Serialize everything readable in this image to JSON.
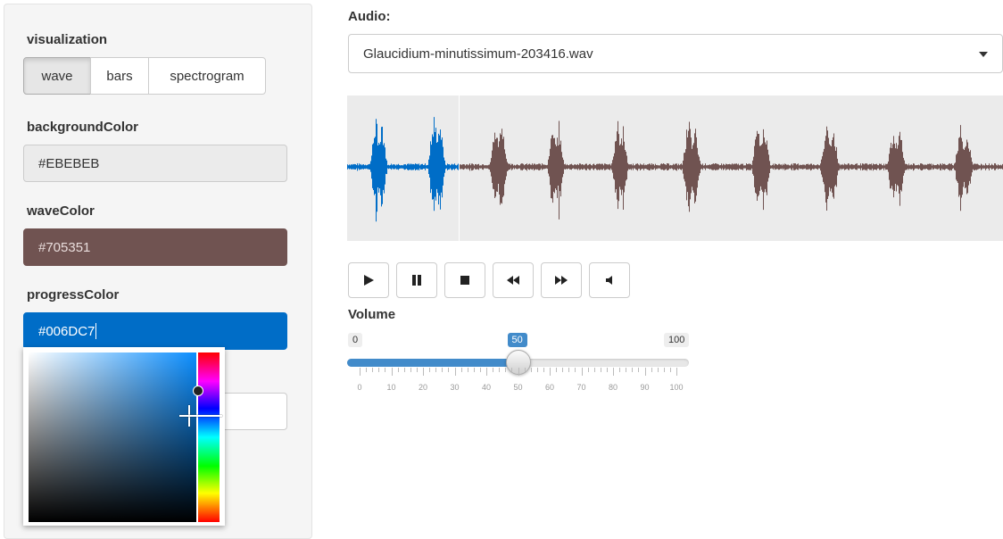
{
  "sidebar": {
    "visualization_label": "visualization",
    "visualization_options": [
      "wave",
      "bars",
      "spectrogram"
    ],
    "visualization_selected": "wave",
    "background_color_label": "backgroundColor",
    "background_color_value": "#EBEBEB",
    "wave_color_label": "waveColor",
    "wave_color_value": "#705351",
    "progress_color_label": "progressColor",
    "progress_color_value": "#006DC7"
  },
  "main": {
    "audio_label": "Audio:",
    "audio_selected": "Glaucidium-minutissimum-203416.wav",
    "wave_color": "#705351",
    "progress_color": "#006DC7",
    "background_color": "#EBEBEB",
    "playback_progress": 0.17,
    "controls": [
      {
        "name": "play-button",
        "icon": "play-icon"
      },
      {
        "name": "pause-button",
        "icon": "pause-icon"
      },
      {
        "name": "stop-button",
        "icon": "stop-icon"
      },
      {
        "name": "rewind-button",
        "icon": "rewind-icon"
      },
      {
        "name": "forward-button",
        "icon": "forward-icon"
      },
      {
        "name": "mute-button",
        "icon": "volume-icon"
      }
    ]
  },
  "volume": {
    "label": "Volume",
    "min": 0,
    "max": 100,
    "value": 50,
    "min_label": "0",
    "max_label": "100",
    "value_label": "50",
    "tick_labels": [
      "0",
      "10",
      "20",
      "30",
      "40",
      "50",
      "60",
      "70",
      "80",
      "90",
      "100"
    ]
  }
}
